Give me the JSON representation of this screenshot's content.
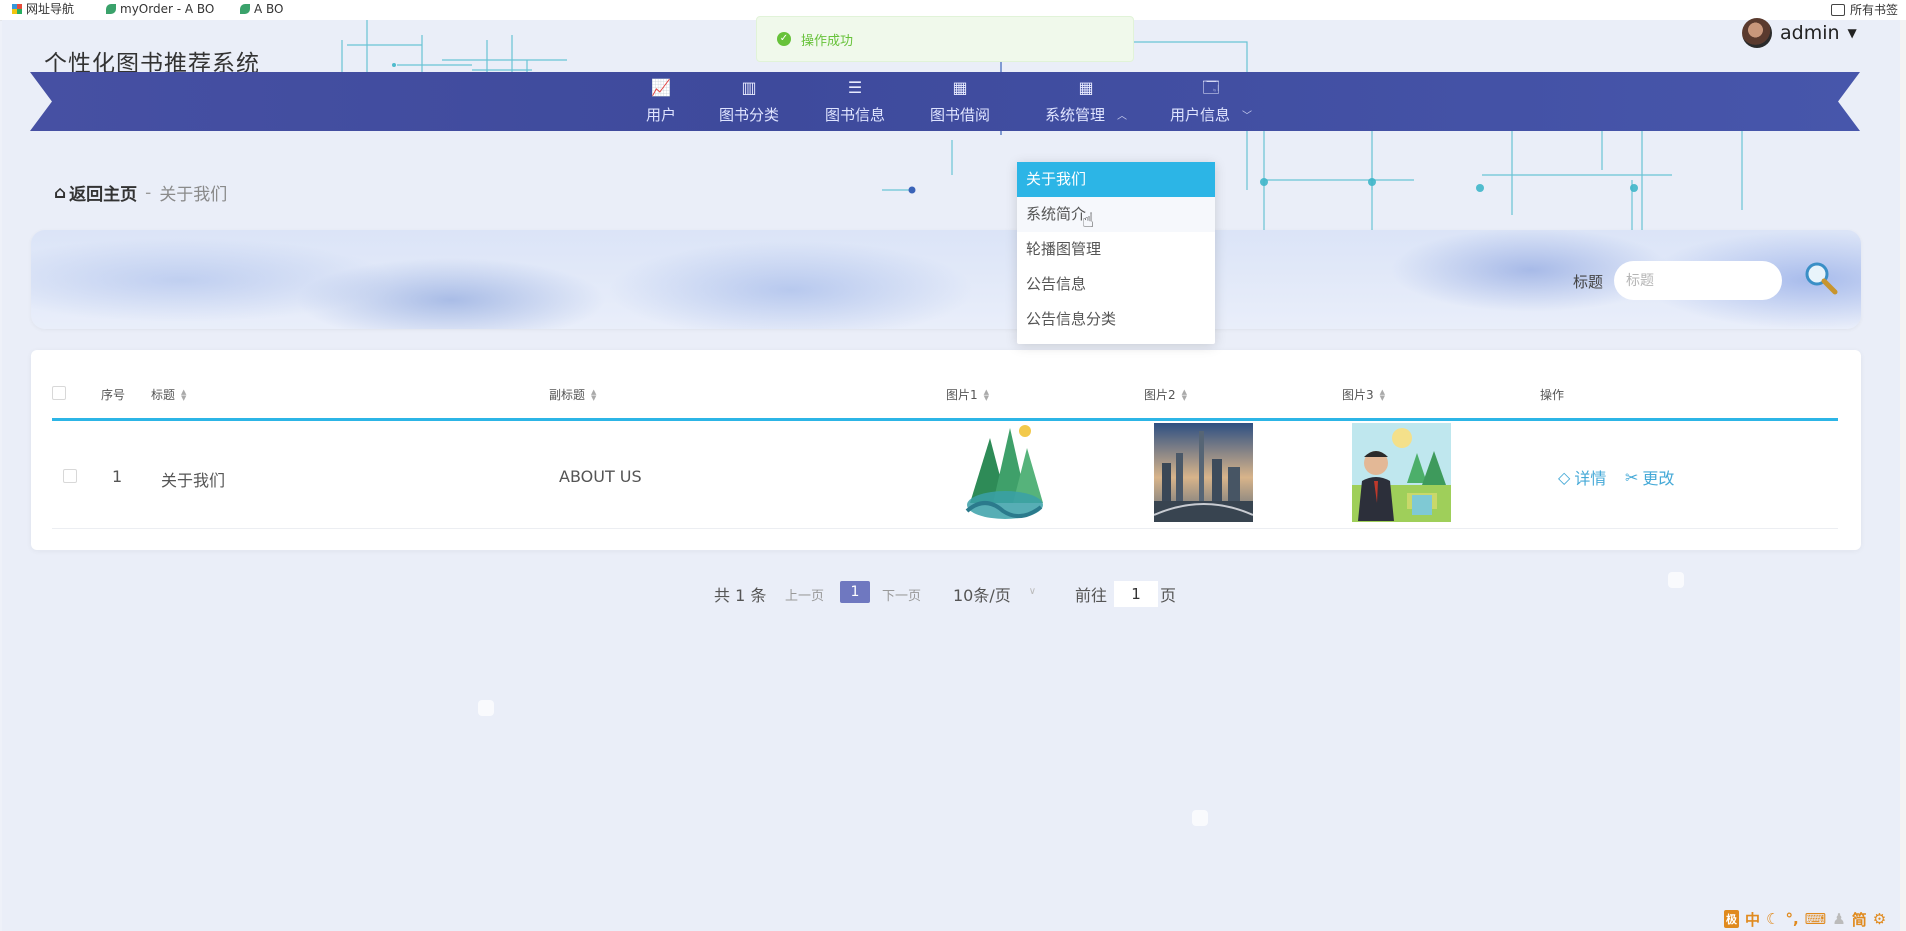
{
  "bookmarks": [
    "网址导航",
    "myOrder - A BO",
    "A BO"
  ],
  "bookmarks_right": "所有书签",
  "app": {
    "title": "个性化图书推荐系统",
    "user": "admin"
  },
  "toast": "操作成功",
  "nav": [
    {
      "label": "用户",
      "icon": "chart-icon"
    },
    {
      "label": "图书分类",
      "icon": "book-icon"
    },
    {
      "label": "图书信息",
      "icon": "list-icon"
    },
    {
      "label": "图书借阅",
      "icon": "grid-icon"
    },
    {
      "label": "系统管理",
      "icon": "grid-icon",
      "expanded": true
    },
    {
      "label": "用户信息",
      "icon": "window-icon"
    }
  ],
  "dropdown": [
    "关于我们",
    "系统简介",
    "轮播图管理",
    "公告信息",
    "公告信息分类"
  ],
  "breadcrumb": {
    "home": "返回主页",
    "sep": "-",
    "current": "关于我们"
  },
  "search": {
    "label": "标题",
    "placeholder": "标题"
  },
  "table": {
    "headers": [
      "序号",
      "标题",
      "副标题",
      "图片1",
      "图片2",
      "图片3",
      "操作"
    ],
    "rows": [
      {
        "index": "1",
        "title": "关于我们",
        "subtitle": "ABOUT US",
        "images": [
          "earth-day-poster",
          "city-skyline-photo",
          "cartoon-man-park"
        ]
      }
    ],
    "actions": {
      "detail": "详情",
      "edit": "更改"
    }
  },
  "pagination": {
    "total": "共 1 条",
    "prev": "上一页",
    "current": "1",
    "next": "下一页",
    "page_size": "10条/页",
    "goto": "前往",
    "goto_value": "1",
    "page_suffix": "页"
  },
  "ime": {
    "badge": "极",
    "lang": "中",
    "mode": "简"
  },
  "colors": {
    "nav": "#4650a3",
    "accent": "#2cb5e6",
    "success": "#67c23a",
    "link": "#45a9d7",
    "pager_active": "#6f78c0"
  }
}
